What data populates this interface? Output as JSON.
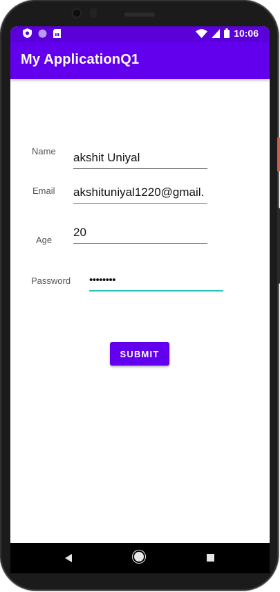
{
  "status_bar": {
    "time": "10:06",
    "left_icons": [
      "shield-icon",
      "circle-icon",
      "sim-card-icon"
    ],
    "right_icons": [
      "wifi-icon",
      "signal-icon",
      "battery-icon"
    ],
    "color": "#5a00d9"
  },
  "app_bar": {
    "title": "My ApplicationQ1",
    "color": "#6200ee"
  },
  "form": {
    "name": {
      "label": "Name",
      "value": "akshit Uniyal"
    },
    "email": {
      "label": "Email",
      "value": "akshituniyal1220@gmail."
    },
    "age": {
      "label": "Age",
      "value": "20"
    },
    "password": {
      "label": "Password",
      "value": "••••••••",
      "focused": true,
      "accent": "#26c6b5"
    }
  },
  "submit": {
    "label": "SUBMIT"
  },
  "nav_bar": {
    "icons": [
      "back-icon",
      "home-icon",
      "recents-icon"
    ]
  }
}
